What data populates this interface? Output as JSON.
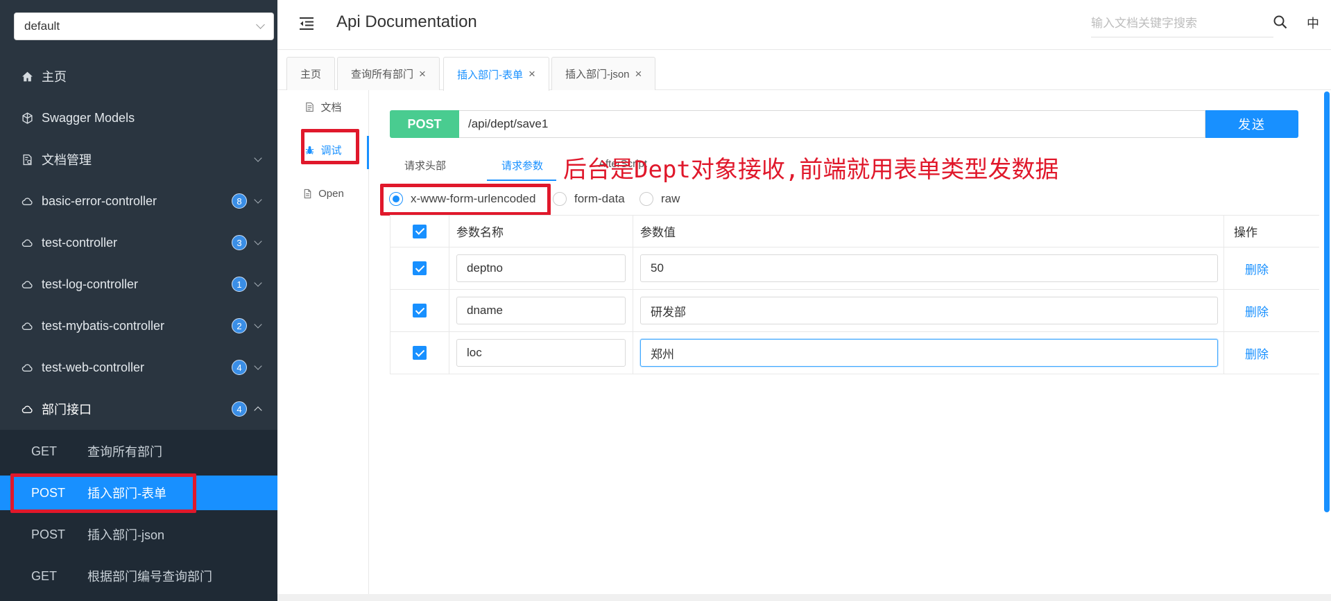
{
  "sidebar": {
    "group_select": "default",
    "items": [
      {
        "label": "主页",
        "icon": "home-icon"
      },
      {
        "label": "Swagger Models",
        "icon": "cube-icon"
      },
      {
        "label": "文档管理",
        "icon": "doc-manage-icon"
      },
      {
        "label": "basic-error-controller",
        "icon": "cloud-icon",
        "badge": "8"
      },
      {
        "label": "test-controller",
        "icon": "cloud-icon",
        "badge": "3"
      },
      {
        "label": "test-log-controller",
        "icon": "cloud-icon",
        "badge": "1"
      },
      {
        "label": "test-mybatis-controller",
        "icon": "cloud-icon",
        "badge": "2"
      },
      {
        "label": "test-web-controller",
        "icon": "cloud-icon",
        "badge": "4"
      },
      {
        "label": "部门接口",
        "icon": "cloud-icon",
        "badge": "4"
      }
    ],
    "sub_items": [
      {
        "method": "GET",
        "title": "查询所有部门"
      },
      {
        "method": "POST",
        "title": "插入部门-表单"
      },
      {
        "method": "POST",
        "title": "插入部门-json"
      },
      {
        "method": "GET",
        "title": "根据部门编号查询部门"
      }
    ]
  },
  "header": {
    "title": "Api Documentation",
    "search_placeholder": "输入文档关键字搜索",
    "lang": "中"
  },
  "tabs": [
    {
      "label": "主页"
    },
    {
      "label": "查询所有部门"
    },
    {
      "label": "插入部门-表单"
    },
    {
      "label": "插入部门-json"
    }
  ],
  "side_tabs": [
    {
      "label": "文档"
    },
    {
      "label": "调试"
    },
    {
      "label": "Open"
    }
  ],
  "request": {
    "method": "POST",
    "url": "/api/dept/save1",
    "send_label": "发送"
  },
  "sub_tabs": [
    {
      "label": "请求头部"
    },
    {
      "label": "请求参数"
    },
    {
      "label": "AfterScript"
    }
  ],
  "annotation": "后台是Dept对象接收,前端就用表单类型发数据",
  "content_types": [
    {
      "label": "x-www-form-urlencoded"
    },
    {
      "label": "form-data"
    },
    {
      "label": "raw"
    }
  ],
  "param_table": {
    "headers": {
      "name": "参数名称",
      "value": "参数值",
      "action": "操作"
    },
    "rows": [
      {
        "name": "deptno",
        "value": "50",
        "action": "删除"
      },
      {
        "name": "dname",
        "value": "研发部",
        "action": "删除"
      },
      {
        "name": "loc",
        "value": "郑州",
        "action": "删除"
      }
    ]
  },
  "colors": {
    "sidebar_bg": "#2a3540",
    "accent": "#1890ff",
    "post_badge": "#49cc90",
    "annotation_red": "#e0182b"
  }
}
